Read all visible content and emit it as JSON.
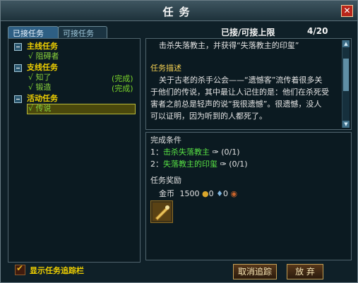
{
  "window": {
    "title": "任务"
  },
  "tabs": [
    {
      "label": "已接任务",
      "active": true
    },
    {
      "label": "可接任务",
      "active": false
    }
  ],
  "header": {
    "label": "已接/可接上限",
    "count": "4/20"
  },
  "tree": {
    "categories": [
      {
        "label": "主线任务",
        "quests": [
          {
            "label": "阻碍者",
            "status": ""
          }
        ]
      },
      {
        "label": "支线任务",
        "quests": [
          {
            "label": "知了",
            "status": "(完成)"
          },
          {
            "label": "锻造",
            "status": "(完成)"
          }
        ]
      },
      {
        "label": "活动任务",
        "quests": [
          {
            "label": "传说",
            "status": ""
          }
        ]
      }
    ]
  },
  "quest_detail": {
    "summary": "击杀失落教主，并获得“失落教主的印玺”",
    "desc_title": "任务描述",
    "desc_lines": [
      "关于古老的杀手公会——“遗憾客”流传着很多关",
      "于他们的传说，其中最让人记住的是：他们在杀死受",
      "害者之前总是轻声的说“我很遗憾”。很遗憾，没人",
      "可以证明，因为听到的人都死了。"
    ]
  },
  "conditions": {
    "title": "完成条件",
    "items": [
      {
        "index": "1：",
        "target": "击杀失落教主",
        "progress": "(0/1)"
      },
      {
        "index": "2：",
        "target": "失落教主的印玺",
        "progress": "(0/1)"
      }
    ]
  },
  "rewards": {
    "title": "任务奖励",
    "gold_label": "金币",
    "gold_value": "1500",
    "val1": "0",
    "val2": "0"
  },
  "footer": {
    "show_tracker_label": "显示任务追踪栏",
    "cancel_label": "取消追踪",
    "abandon_label": "放 弃"
  },
  "colors": {
    "accent": "#f0d000",
    "quest": "#8ad13b",
    "button_border": "#c6a055"
  }
}
